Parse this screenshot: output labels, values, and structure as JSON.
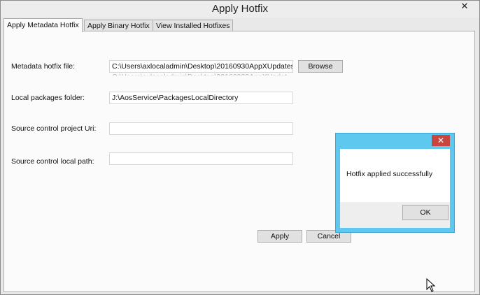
{
  "window": {
    "title": "Apply Hotfix",
    "close_glyph": "✕"
  },
  "tabs": [
    {
      "label": "Apply Metadata Hotfix",
      "active": true
    },
    {
      "label": "Apply Binary Hotfix",
      "active": false
    },
    {
      "label": "View Installed Hotfixes",
      "active": false
    }
  ],
  "form": {
    "metadata_file_label": "Metadata hotfix file:",
    "metadata_file_value": "C:\\Users\\axlocaladmin\\Desktop\\20160930AppXUpdates",
    "browse_label": "Browse",
    "packages_folder_label": "Local packages folder:",
    "packages_folder_value": "J:\\AosService\\PackagesLocalDirectory",
    "project_uri_label": "Source control project Uri:",
    "project_uri_value": "",
    "local_path_label": "Source control local path:",
    "local_path_value": "",
    "apply_label": "Apply",
    "cancel_label": "Cancel"
  },
  "dialog": {
    "message": "Hotfix applied successfully",
    "ok_label": "OK",
    "close_glyph": "✕",
    "frame_color": "#5ec8ee",
    "close_color": "#c9463f"
  },
  "icons": {
    "cursor": "arrow-cursor-icon"
  }
}
